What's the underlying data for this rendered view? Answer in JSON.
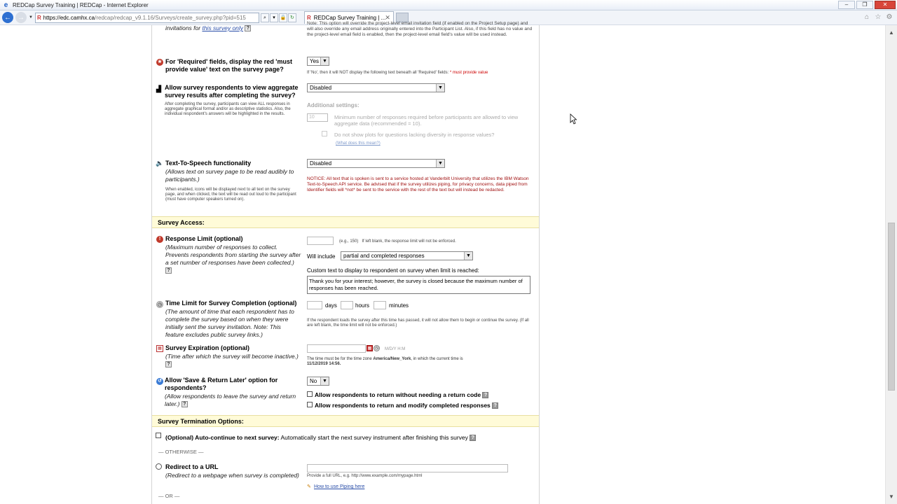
{
  "browser": {
    "title": "REDCap Survey Training | REDCap - Internet Explorer",
    "url_host": "https://edc.camhx.ca",
    "url_rest": "/redcap/redcap_v9.1.16/Surveys/create_survey.php?pid=515",
    "tab_label": "REDCap Survey Training | ...",
    "win_min": "–",
    "win_restore": "❐",
    "win_close": "✕"
  },
  "top_fragment": {
    "left": "invitations for",
    "left_link": "this survey only",
    "right": "Note: This option will override the project-level email invitation field (if enabled on the Project Setup page) and will also override any email address originally entered into the Participant List. Also, if this field has no value and the project-level email field is enabled, then the project-level email field's value will be used instead."
  },
  "required_fields": {
    "label": "For 'Required' fields, display the red 'must provide value' text on the survey page?",
    "value": "Yes",
    "note_prefix": "If 'No', then it will NOT display the following text beneath all 'Required' fields:",
    "note_red": "* must provide value"
  },
  "aggregate": {
    "label": "Allow survey respondents to view aggregate survey results after completing the survey?",
    "desc": "After completing the survey, participants can view ALL responses in aggregate graphical format and/or as descriptive statistics. Also, the individual respondent's answers will be highlighted in the results.",
    "value": "Disabled",
    "additional": "Additional settings:",
    "min_value": "10",
    "min_text": "Minimum number of responses required before participants are allowed to view aggregate data (recommended = 10).",
    "no_plots": "Do not show plots for questions lacking diversity in response values?",
    "what_link": "(What does this mean?)"
  },
  "tts": {
    "label": "Text-To-Speech functionality",
    "desc": "(Allows text on survey page to be read audibly to participants.)",
    "desc2": "When enabled, icons will be displayed next to all text on the survey page, and when clicked, the text will be read out loud to the participant (must have computer speakers turned on).",
    "value": "Disabled",
    "notice": "NOTICE: All text that is spoken is sent to a service hosted at Vanderbilt University that utilizes the IBM Watson Text-to-Speech API service. Be advised that if the survey utilizes piping, for privacy concerns, data piped from Identifier fields will *not* be sent to the service with the rest of the text but will instead be redacted."
  },
  "survey_access": {
    "heading": "Survey Access:"
  },
  "response_limit": {
    "label": "Response Limit (optional)",
    "desc": "(Maximum number of responses to collect. Prevents respondents from starting the survey after a set number of responses have been collected.)",
    "hint": "(e.g., 150)",
    "hint2": "If left blank, the response limit will not be enforced.",
    "will_include": "Will include",
    "include_value": "partial and completed responses",
    "custom_text_label": "Custom text to display to respondent on survey when limit is reached:",
    "custom_text": "Thank you for your interest; however, the survey is closed because the maximum number of responses has been reached."
  },
  "time_limit": {
    "label": "Time Limit for Survey Completion (optional)",
    "desc": "(The amount of time that each respondent has to complete the survey based on when they were initially sent the survey invitation. Note: This feature excludes public survey links.)",
    "days": "days",
    "hours": "hours",
    "minutes": "minutes",
    "note": "If the respondent loads the survey after this time has passed, it will not allow them to begin or continue the survey. (If all are left blank, the time limit will not be enforced.)"
  },
  "expiration": {
    "label": "Survey Expiration (optional)",
    "desc": "(Time after which the survey will become inactive.)",
    "format": "M/D/Y H:M",
    "tz_note_prefix": "The time must be for the time zone",
    "tz": "America/New_York",
    "tz_note_mid": ", in which the current time is",
    "current_time": "11/12/2019 14:56."
  },
  "save_return": {
    "label": "Allow 'Save & Return Later' option for respondents?",
    "desc": "(Allow respondents to leave the survey and return later.)",
    "value": "No",
    "opt1": "Allow respondents to return without needing a return code",
    "opt2": "Allow respondents to return and modify completed responses"
  },
  "termination": {
    "heading": "Survey Termination Options:",
    "auto_bold": "(Optional) Auto-continue to next survey:",
    "auto_text": "Automatically start the next survey instrument after finishing this survey",
    "otherwise": "— OTHERWISE —",
    "redirect_label": "Redirect to a URL",
    "redirect_desc": "(Redirect to a webpage when survey is completed)",
    "url_hint": "Provide a full URL, e.g. http://www.example.com/mypage.html",
    "piping_link": "How to use Piping here",
    "or": "— OR —"
  }
}
